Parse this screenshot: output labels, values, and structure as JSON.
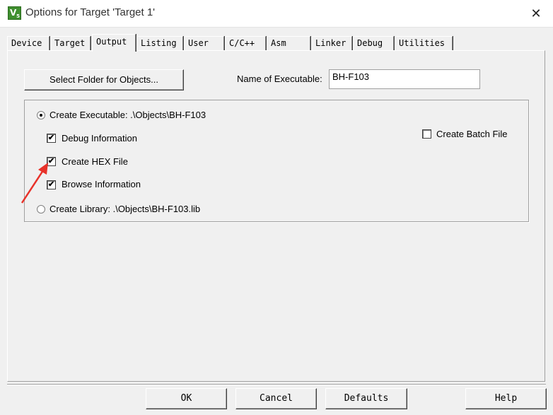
{
  "window": {
    "title": "Options for Target 'Target 1'",
    "icon": "keil-uvision-icon",
    "close_glyph": "✕"
  },
  "tabs": [
    {
      "label": "Device",
      "active": false
    },
    {
      "label": "Target",
      "active": false
    },
    {
      "label": "Output",
      "active": true
    },
    {
      "label": "Listing",
      "active": false
    },
    {
      "label": "User",
      "active": false
    },
    {
      "label": "C/C++",
      "active": false
    },
    {
      "label": "Asm",
      "active": false
    },
    {
      "label": "Linker",
      "active": false
    },
    {
      "label": "Debug",
      "active": false
    },
    {
      "label": "Utilities",
      "active": false
    }
  ],
  "output": {
    "select_folder_label": "Select Folder for Objects...",
    "name_of_executable_label": "Name of Executable:",
    "name_of_executable_value": "BH-F103",
    "create_executable": {
      "label": "Create Executable:  .\\Objects\\BH-F103",
      "selected": true
    },
    "debug_information": {
      "label": "Debug Information",
      "checked": true
    },
    "create_hex_file": {
      "label": "Create HEX File",
      "checked": true
    },
    "browse_information": {
      "label": "Browse Information",
      "checked": true
    },
    "create_library": {
      "label": "Create Library:  .\\Objects\\BH-F103.lib",
      "selected": false
    },
    "create_batch_file": {
      "label": "Create Batch File",
      "checked": false
    },
    "check_glyph": "✔"
  },
  "footer": {
    "ok": "OK",
    "cancel": "Cancel",
    "defaults": "Defaults",
    "help": "Help"
  },
  "colors": {
    "annotation_arrow": "#e8322a",
    "dialog_bg": "#f0f0f0"
  }
}
